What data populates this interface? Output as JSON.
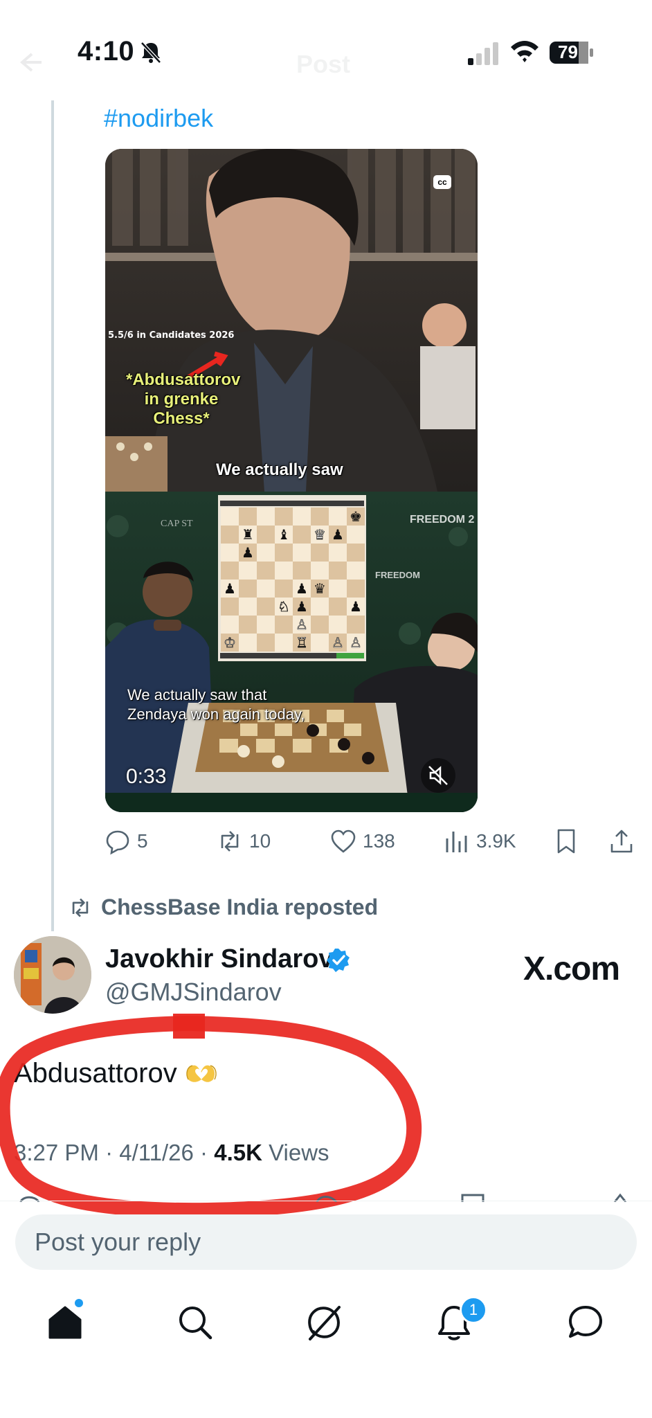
{
  "status_bar": {
    "time": "4:10",
    "battery": "79",
    "nav_title": "Post"
  },
  "previous_post": {
    "hashtag": "#nodirbek",
    "video": {
      "cc_label": "cc",
      "overlay_stat": "5.5/6 in Candidates 2026",
      "caption_top": "*Abdusattorov in grenke Chess*",
      "caption_mid": "We actually saw",
      "subtitle": "We actually saw that Zendaya won again today,",
      "duration": "0:33"
    },
    "actions": {
      "replies": "5",
      "reposts": "10",
      "likes": "138",
      "views": "3.9K"
    }
  },
  "repost_banner": "ChessBase India reposted",
  "post": {
    "author_name": "Javokhir Sindarov",
    "handle": "@GMJSindarov",
    "source_logo": "X.com",
    "text": "Abdusattorov",
    "time": "3:27 PM",
    "date": "4/11/26",
    "views_count": "4.5K",
    "views_label": "Views"
  },
  "reply": {
    "placeholder": "Post your reply"
  },
  "tab_bar": {
    "notifications_badge": "1"
  },
  "colors": {
    "accent": "#1d9bf0",
    "secondary_text": "#536471",
    "annotation": "#e8261f"
  }
}
